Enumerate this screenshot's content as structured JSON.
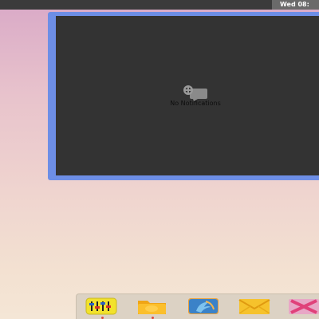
{
  "top_bar": {
    "clock_text": "Wed 08:"
  },
  "notification_panel": {
    "empty_message": "No Notifications",
    "empty_icon": "notification-bubble-icon"
  },
  "dock": {
    "items": [
      {
        "icon": "equalizer-icon",
        "running": true
      },
      {
        "icon": "folder-icon",
        "running": true
      },
      {
        "icon": "browser-icon",
        "running": false
      },
      {
        "icon": "mail-icon",
        "running": false
      },
      {
        "icon": "close-x-icon",
        "running": false
      }
    ]
  },
  "colors": {
    "panel_border": "#6d8ee6",
    "panel_bg": "#333333",
    "top_bar": "#3b3b3b",
    "running_indicator": "#e0483a"
  }
}
